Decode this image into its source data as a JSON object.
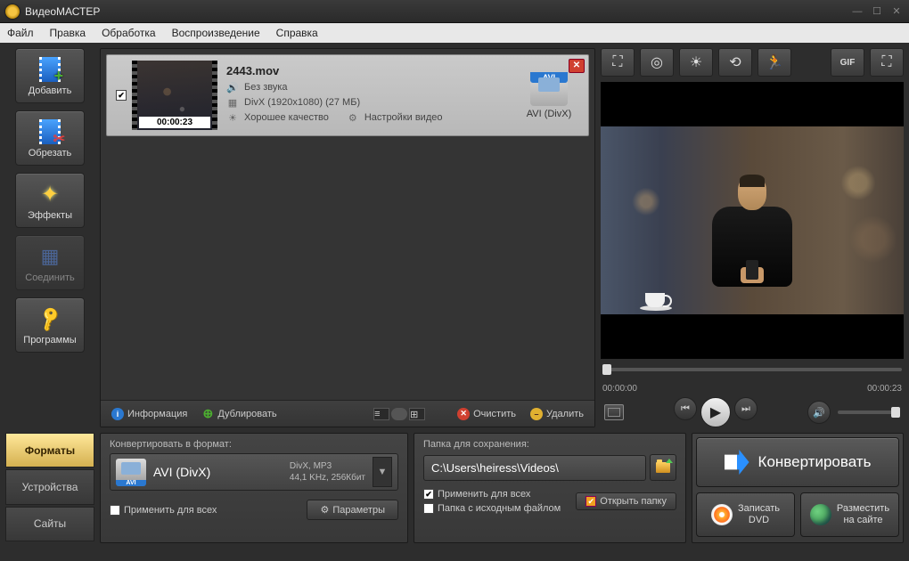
{
  "window": {
    "title": "ВидеоМАСТЕР"
  },
  "menu": [
    "Файл",
    "Правка",
    "Обработка",
    "Воспроизведение",
    "Справка"
  ],
  "sidebar": {
    "add": "Добавить",
    "cut": "Обрезать",
    "effects": "Эффекты",
    "join": "Соединить",
    "programs": "Программы"
  },
  "item": {
    "filename": "2443.mov",
    "audio": "Без звука",
    "codec": "DivX (1920x1080) (27 МБ)",
    "quality": "Хорошее качество",
    "settings": "Настройки видео",
    "duration": "00:00:23",
    "format_badge": "AVI",
    "format_label": "AVI (DivX)"
  },
  "listbar": {
    "info": "Информация",
    "duplicate": "Дублировать",
    "clear": "Очистить",
    "delete": "Удалить"
  },
  "preview": {
    "time_start": "00:00:00",
    "time_end": "00:00:23"
  },
  "tabs": {
    "formats": "Форматы",
    "devices": "Устройства",
    "sites": "Сайты"
  },
  "format_panel": {
    "title": "Конвертировать в формат:",
    "badge": "AVI",
    "name": "AVI (DivX)",
    "detail1": "DivX, MP3",
    "detail2": "44,1 KHz, 256Кбит",
    "apply_all": "Применить для всех",
    "params": "Параметры"
  },
  "save_panel": {
    "title": "Папка для сохранения:",
    "path": "C:\\Users\\heiress\\Videos\\",
    "apply_all": "Применить для всех",
    "source_folder": "Папка с исходным файлом",
    "open_folder": "Открыть папку"
  },
  "actions": {
    "convert": "Конвертировать",
    "dvd1": "Записать",
    "dvd2": "DVD",
    "web1": "Разместить",
    "web2": "на сайте"
  }
}
